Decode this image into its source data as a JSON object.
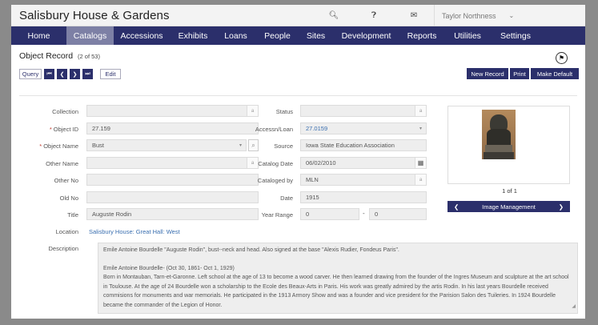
{
  "app": {
    "title": "Salisbury House & Gardens"
  },
  "top_icons": [
    {
      "name": "search-icon",
      "glyph": "🔍︎"
    },
    {
      "name": "help-icon",
      "glyph": "❓︎"
    },
    {
      "name": "mail-icon",
      "glyph": "✉"
    }
  ],
  "user": {
    "name": "Taylor Northness"
  },
  "nav": [
    {
      "label": "Home"
    },
    {
      "label": "Catalogs",
      "active": true
    },
    {
      "label": "Accessions"
    },
    {
      "label": "Exhibits"
    },
    {
      "label": "Loans"
    },
    {
      "label": "People"
    },
    {
      "label": "Sites"
    },
    {
      "label": "Development"
    },
    {
      "label": "Reports"
    },
    {
      "label": "Utilities"
    },
    {
      "label": "Settings"
    }
  ],
  "record": {
    "title": "Object Record",
    "count": "(2 of 53)",
    "query_label": "Query",
    "edit_label": "Edit",
    "nav_first": "⏮",
    "nav_prev": "❮",
    "nav_next": "❯",
    "nav_last": "⏭"
  },
  "actions": {
    "new_record": "New Record",
    "print": "Print",
    "make_default": "Make Default"
  },
  "left_fields": {
    "collection": {
      "label": "Collection",
      "value": ""
    },
    "object_id": {
      "label": "Object ID",
      "value": "27.159"
    },
    "object_name": {
      "label": "Object Name",
      "value": "Bust"
    },
    "other_name": {
      "label": "Other Name",
      "value": ""
    },
    "other_no": {
      "label": "Other No",
      "value": ""
    },
    "old_no": {
      "label": "Old No",
      "value": ""
    },
    "title": {
      "label": "Title",
      "value": "Auguste Rodin"
    },
    "location": {
      "label": "Location",
      "value": "Salisbury House: Great Hall: West"
    }
  },
  "right_fields": {
    "status": {
      "label": "Status",
      "value": ""
    },
    "accession_loan": {
      "label": "Accessn/Loan",
      "value": "27.0159"
    },
    "source": {
      "label": "Source",
      "value": "Iowa State Education Association"
    },
    "catalog_date": {
      "label": "Catalog Date",
      "value": "06/02/2010"
    },
    "cataloged_by": {
      "label": "Cataloged by",
      "value": "MLN"
    },
    "date": {
      "label": "Date",
      "value": "1915"
    },
    "year_range": {
      "label": "Year Range",
      "from": "0",
      "to": "0",
      "sep": "-"
    }
  },
  "image": {
    "count": "1 of 1",
    "management_label": "Image Management",
    "prev": "❮",
    "next": "❯"
  },
  "description": {
    "label": "Description",
    "line1": "Emile Antoine Bourdelle \"Auguste Rodin\", bust--neck and head. Also signed at the base \"Alexis Rudier, Fondeus Paris\".",
    "line2": "Emile Antoine Bourdelle- (Oct 30, 1861- Oct 1, 1929)",
    "line3": "Born in Montauban, Tarn-et-Garonne. Left school at the age of 13 to become a wood carver. He then learned drawing from the founder of the Ingres Museum and sculpture at the art school in Toulouse. At the age of 24 Bourdelle won a scholarship to the Ecole des Beaux-Arts in Paris. His work was greatly admired by the artis Rodin. In his last years Bourdelle received commisions for monuments and war memorials. He participated in the 1913 Armory Show and was a founder and vice president for the Parision Salon des Tuileries. In 1924 Bourdelle became the commander of the Legion of Honor."
  }
}
